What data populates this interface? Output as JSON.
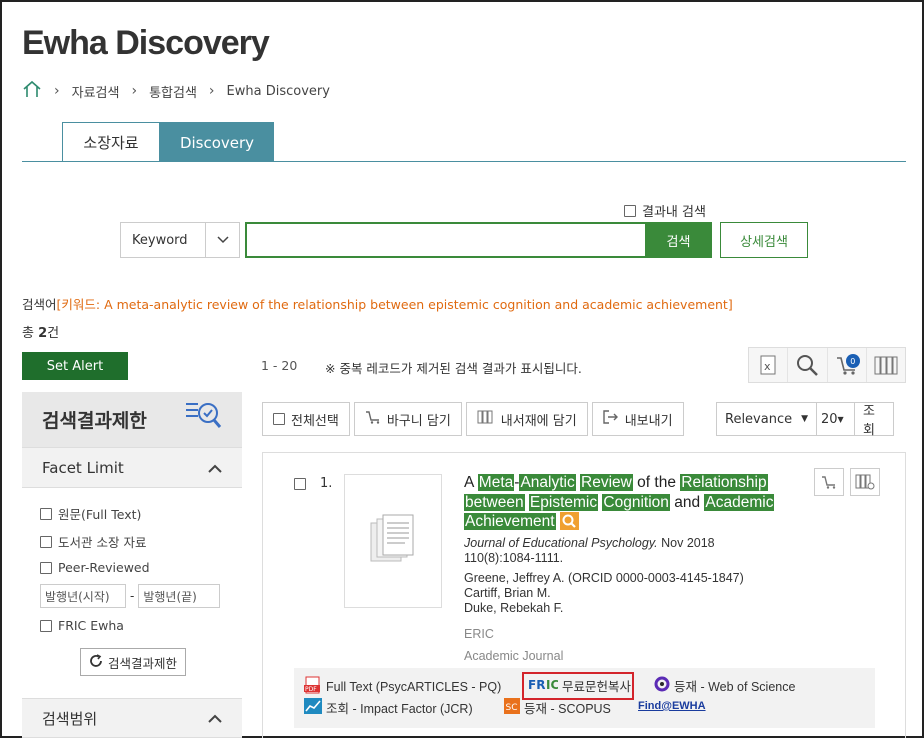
{
  "page": {
    "title": "Ewha Discovery"
  },
  "breadcrumb": {
    "home_icon": "home-icon",
    "items": [
      "자료검색",
      "통합검색",
      "Ewha Discovery"
    ]
  },
  "tabs": [
    {
      "label": "소장자료",
      "active": false
    },
    {
      "label": "Discovery",
      "active": true
    }
  ],
  "search": {
    "within_results_label": "결과내 검색",
    "field_select": "Keyword",
    "query": "",
    "search_button": "검색",
    "advanced_button": "상세검색"
  },
  "query_summary": {
    "label": "검색어",
    "text": "[키워드: A meta-analytic review of the relationship between epistemic cognition and academic achievement]"
  },
  "total": {
    "prefix": "총 ",
    "count": "2",
    "suffix": "건"
  },
  "set_alert": "Set Alert",
  "results_header": {
    "range": "1 - 20",
    "note": "※ 중복 레코드가 제거된 검색 결과가 표시됩니다.",
    "cart_count": "0"
  },
  "facets": {
    "title": "검색결과제한",
    "facet_limit": "Facet Limit",
    "options": [
      "원문(Full Text)",
      "도서관 소장 자료",
      "Peer-Reviewed"
    ],
    "year_from_placeholder": "발행년(시작)",
    "year_dash": "-",
    "year_to_placeholder": "발행년(끝)",
    "fric_option": "FRIC Ewha",
    "apply_button": "검색결과제한",
    "scope": "검색범위"
  },
  "toolbar": {
    "select_all": "전체선택",
    "add_cart": "바구니 담기",
    "add_shelf": "내서재에 담기",
    "export": "내보내기",
    "sort": "Relevance",
    "per_page": "20",
    "view": "조회"
  },
  "result": {
    "number": "1.",
    "title_parts": [
      {
        "t": "A ",
        "hl": false
      },
      {
        "t": "Meta",
        "hl": true
      },
      {
        "t": "-",
        "hl": false
      },
      {
        "t": "Analytic",
        "hl": true
      },
      {
        "t": " ",
        "hl": false
      },
      {
        "t": "Review",
        "hl": true
      },
      {
        "t": " of the ",
        "hl": false
      },
      {
        "t": "Relationship",
        "hl": true
      },
      {
        "t": " ",
        "hl": false
      },
      {
        "t": "between",
        "hl": true
      },
      {
        "t": " ",
        "hl": false
      },
      {
        "t": "Epistemic",
        "hl": true
      },
      {
        "t": " ",
        "hl": false
      },
      {
        "t": "Cognition",
        "hl": true
      },
      {
        "t": " and ",
        "hl": false
      },
      {
        "t": "Academic",
        "hl": true
      },
      {
        "t": " ",
        "hl": false
      },
      {
        "t": "Achievement",
        "hl": true
      }
    ],
    "journal": "Journal of Educational Psychology.",
    "date": " Nov 2018",
    "volume": "110(8):1084-1111.",
    "authors": [
      "Greene, Jeffrey A. (ORCID 0000-0003-4145-1847)",
      "Cartiff, Brian M.",
      "Duke, Rebekah F."
    ],
    "database": "ERIC",
    "type": "Academic Journal",
    "links": {
      "full_text": "Full Text (PsycARTICLES - PQ)",
      "fric": "무료문헌복사",
      "wos": "등재 - Web of Science",
      "jcr": "조회 - Impact Factor (JCR)",
      "scopus": "등재 - SCOPUS",
      "find": "Find@EWHA"
    }
  },
  "colors": {
    "green": "#3a8a3a",
    "teal": "#4a8fa0",
    "orange": "#e06a10",
    "alert_green": "#1f6e2c",
    "red": "#d3242b"
  }
}
